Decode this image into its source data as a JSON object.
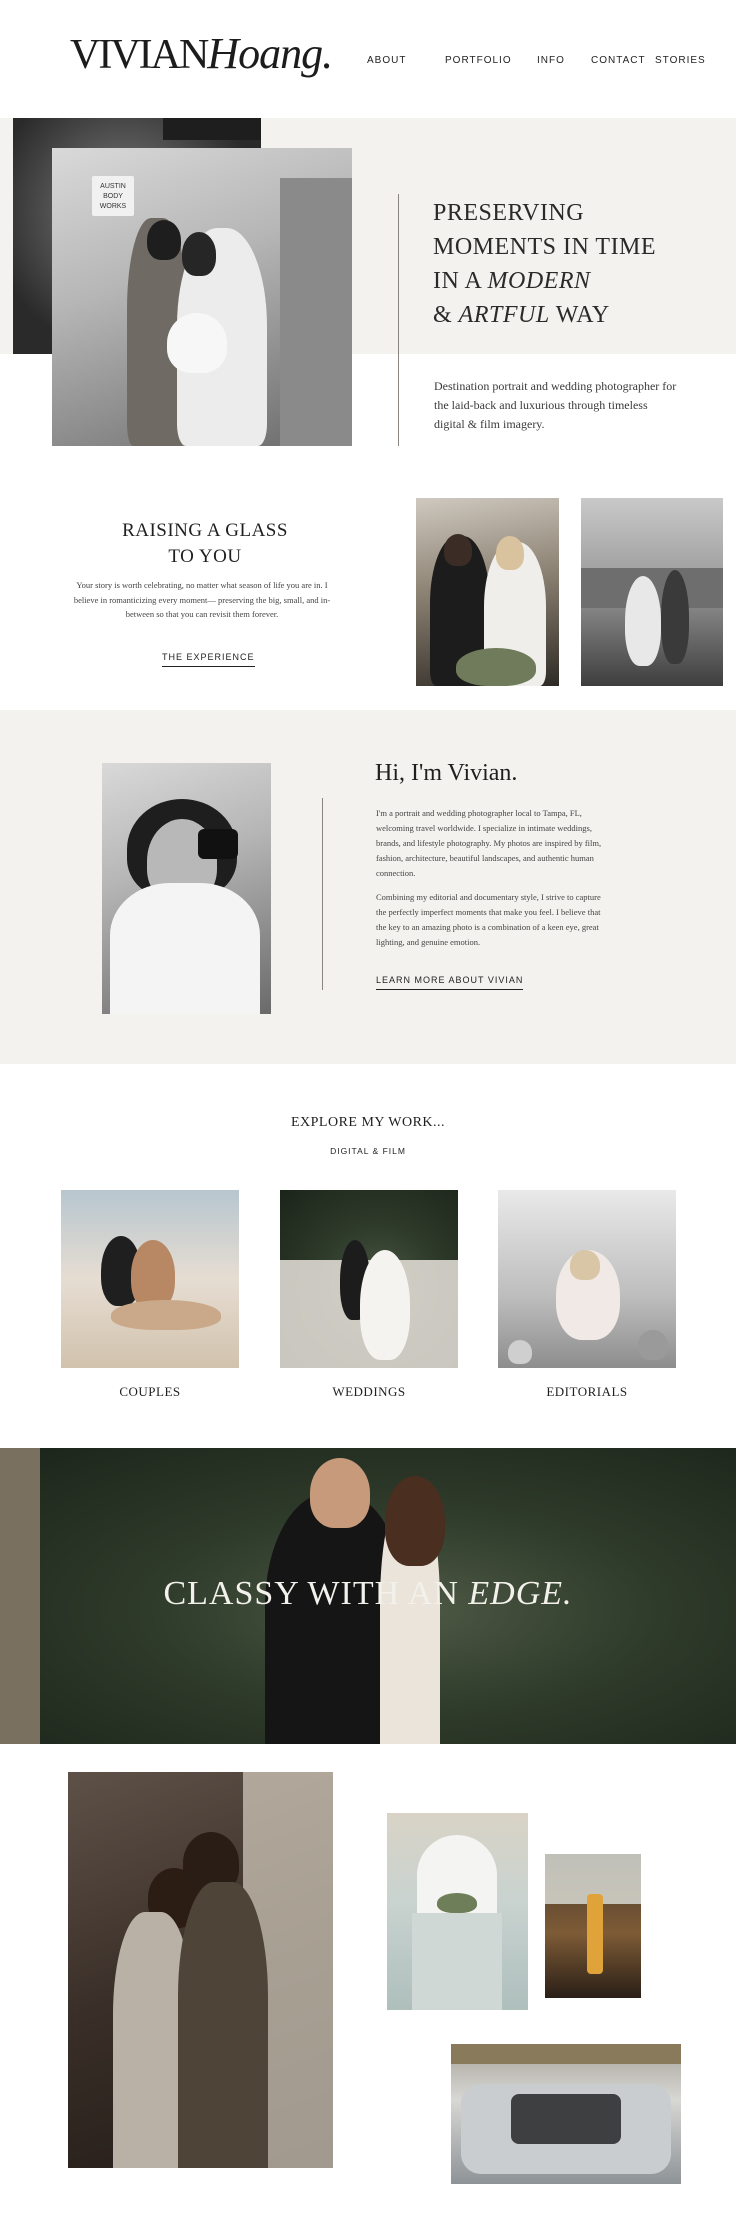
{
  "header": {
    "logo_first": "VIVIAN",
    "logo_second": "Hoang.",
    "nav": [
      "ABOUT",
      "PORTFOLIO",
      "INFO",
      "CONTACT",
      "STORIES"
    ]
  },
  "hero": {
    "title_line1": "PRESERVING",
    "title_line2": "MOMENTS IN TIME",
    "title_line3_prefix": "IN A ",
    "title_line3_italic": "MODERN",
    "title_line4_prefix": "& ",
    "title_line4_italic": "ARTFUL",
    "title_line4_suffix": " WAY",
    "description": "Destination portrait and wedding photographer for the laid-back and luxurious through timeless digital & film imagery.",
    "sign_text": "AUSTIN BODY WORKS"
  },
  "experience": {
    "title_line1": "RAISING A GLASS",
    "title_line2": "TO YOU",
    "body": "Your story is worth celebrating, no matter what season of life you are in. I believe in romanticizing every moment— preserving the big, small, and in-between so that you can revisit them forever.",
    "button": "THE EXPERIENCE"
  },
  "about": {
    "title": "Hi, I'm Vivian.",
    "para1": "I'm a portrait and wedding photographer local to Tampa, FL, welcoming travel worldwide. I specialize in intimate weddings, brands, and lifestyle photography. My photos are inspired by film, fashion, architecture, beautiful landscapes, and authentic human connection.",
    "para2": "Combining my editorial and documentary style, I strive to capture the perfectly imperfect moments that make you feel. I believe that the key to an amazing photo is a combination of a keen eye, great lighting, and genuine emotion.",
    "button": "LEARN MORE ABOUT VIVIAN"
  },
  "explore": {
    "title": "EXPLORE MY WORK...",
    "subtitle": "DIGITAL & FILM",
    "categories": [
      "COUPLES",
      "WEDDINGS",
      "EDITORIALS"
    ]
  },
  "banner": {
    "text_prefix": "CLASSY WITH AN ",
    "text_italic": "EDGE."
  },
  "colors": {
    "beige_bg": "#f4f2ee",
    "text": "#1f1f1f",
    "banner_text": "#f3f1ec"
  }
}
